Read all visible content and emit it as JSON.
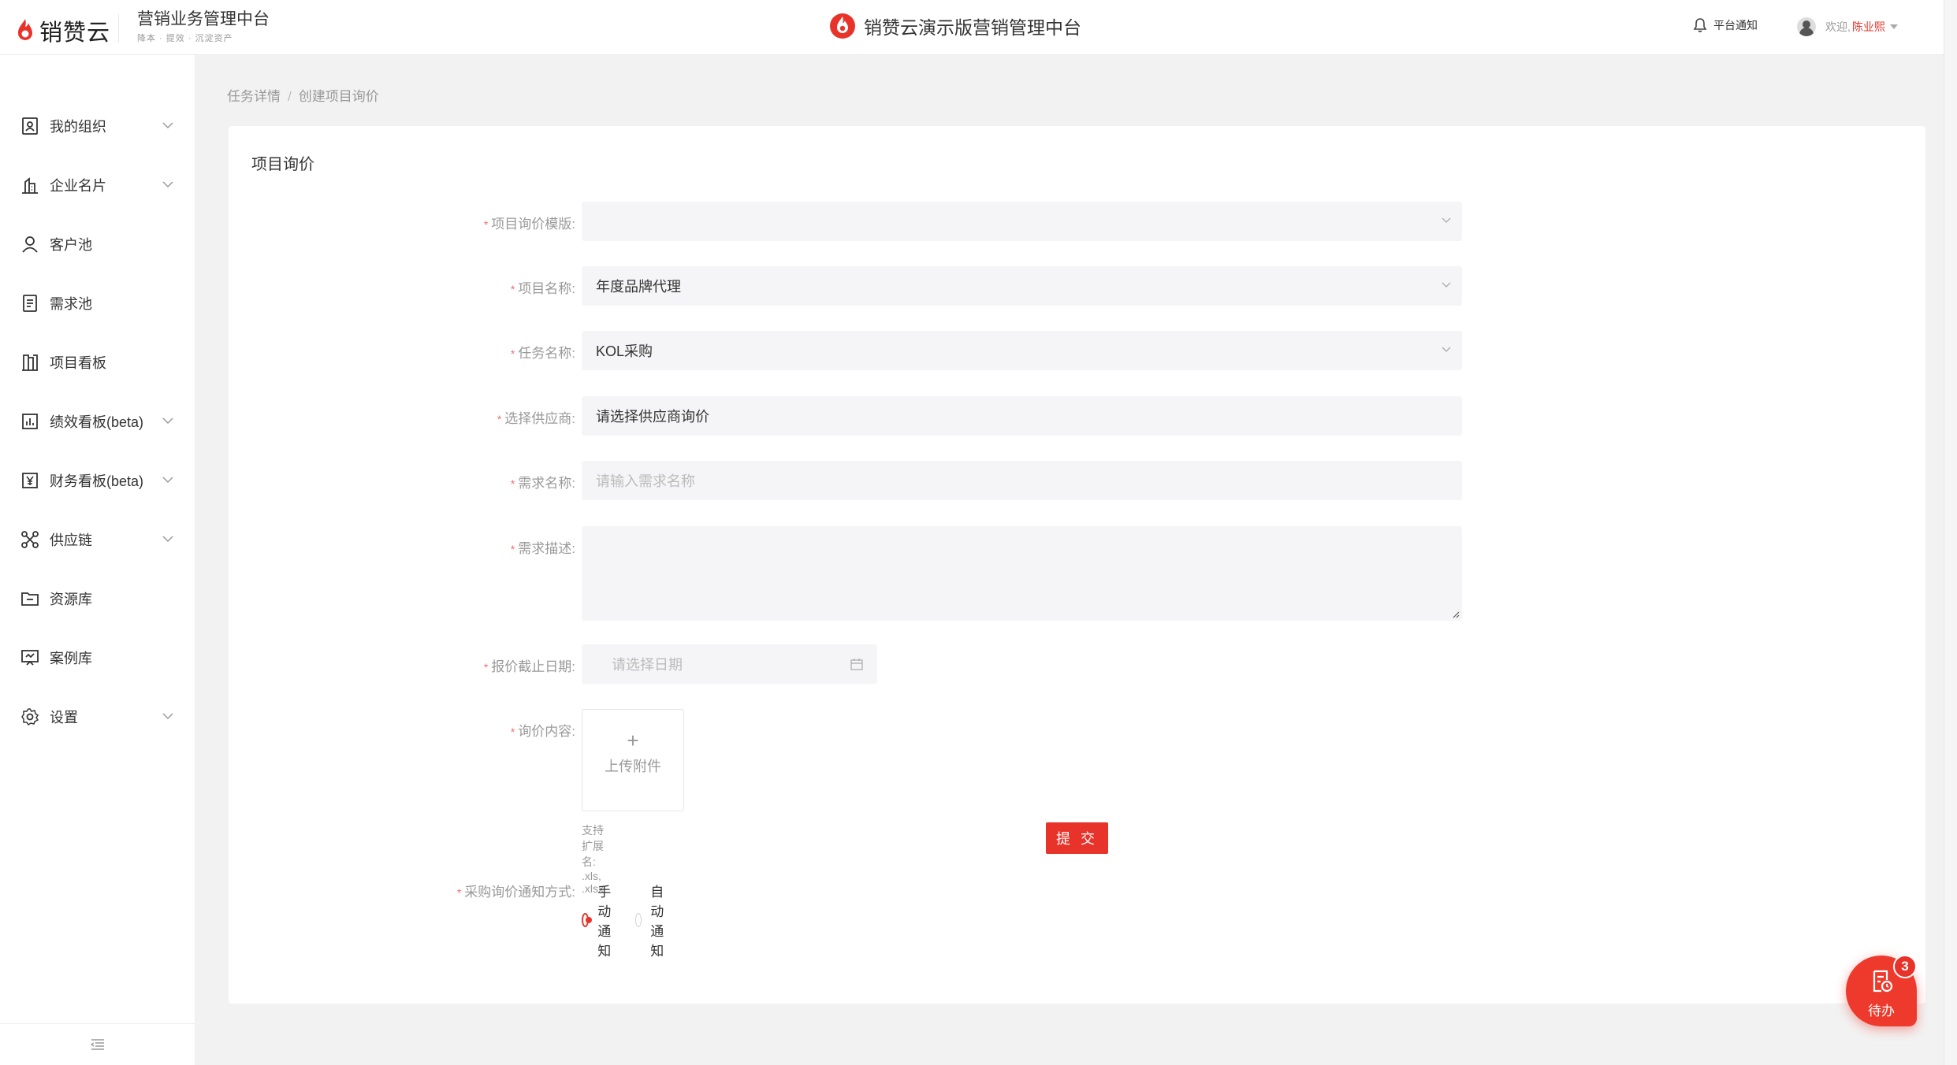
{
  "header": {
    "logo_text": "销赞云",
    "platform_title": "营销业务管理中台",
    "platform_tagline": "降本 · 提效 · 沉淀资产",
    "center_title": "销赞云演示版营销管理中台",
    "notice_label": "平台通知",
    "welcome": "欢迎,",
    "username": "陈业熙"
  },
  "sidebar": {
    "items": [
      {
        "label": "我的组织",
        "icon": "org-icon",
        "has_arrow": true
      },
      {
        "label": "企业名片",
        "icon": "building-icon",
        "has_arrow": true
      },
      {
        "label": "客户池",
        "icon": "user-icon",
        "has_arrow": false
      },
      {
        "label": "需求池",
        "icon": "list-icon",
        "has_arrow": false
      },
      {
        "label": "项目看板",
        "icon": "board-icon",
        "has_arrow": false
      },
      {
        "label": "绩效看板(beta)",
        "icon": "chart-icon",
        "has_arrow": true
      },
      {
        "label": "财务看板(beta)",
        "icon": "yuan-icon",
        "has_arrow": true
      },
      {
        "label": "供应链",
        "icon": "network-icon",
        "has_arrow": true
      },
      {
        "label": "资源库",
        "icon": "folder-icon",
        "has_arrow": false
      },
      {
        "label": "案例库",
        "icon": "presentation-icon",
        "has_arrow": false
      },
      {
        "label": "设置",
        "icon": "gear-icon",
        "has_arrow": true
      }
    ]
  },
  "breadcrumb": {
    "items": [
      "任务详情",
      "创建项目询价"
    ],
    "separator": "/"
  },
  "form": {
    "card_title": "项目询价",
    "template": {
      "label": "项目询价模版:",
      "value": ""
    },
    "project_name": {
      "label": "项目名称:",
      "value": "年度品牌代理"
    },
    "task_name": {
      "label": "任务名称:",
      "value": "KOL采购"
    },
    "supplier": {
      "label": "选择供应商:",
      "value": "请选择供应商询价"
    },
    "demand_name": {
      "label": "需求名称:",
      "placeholder": "请输入需求名称"
    },
    "demand_desc": {
      "label": "需求描述:",
      "value": ""
    },
    "deadline": {
      "label": "报价截止日期:",
      "placeholder": "请选择日期"
    },
    "content": {
      "label": "询价内容:",
      "upload_label": "上传附件",
      "hint": "支持扩展名: .xls, .xlsx"
    },
    "notify": {
      "label": "采购询价通知方式:",
      "options": [
        "手动通知",
        "自动通知"
      ],
      "selected": "手动通知"
    },
    "submit_label": "提 交"
  },
  "todo": {
    "label": "待办",
    "count": "3"
  },
  "colors": {
    "accent": "#e8332a",
    "field_bg": "#f5f5f7",
    "page_bg": "#f2f2f2"
  }
}
